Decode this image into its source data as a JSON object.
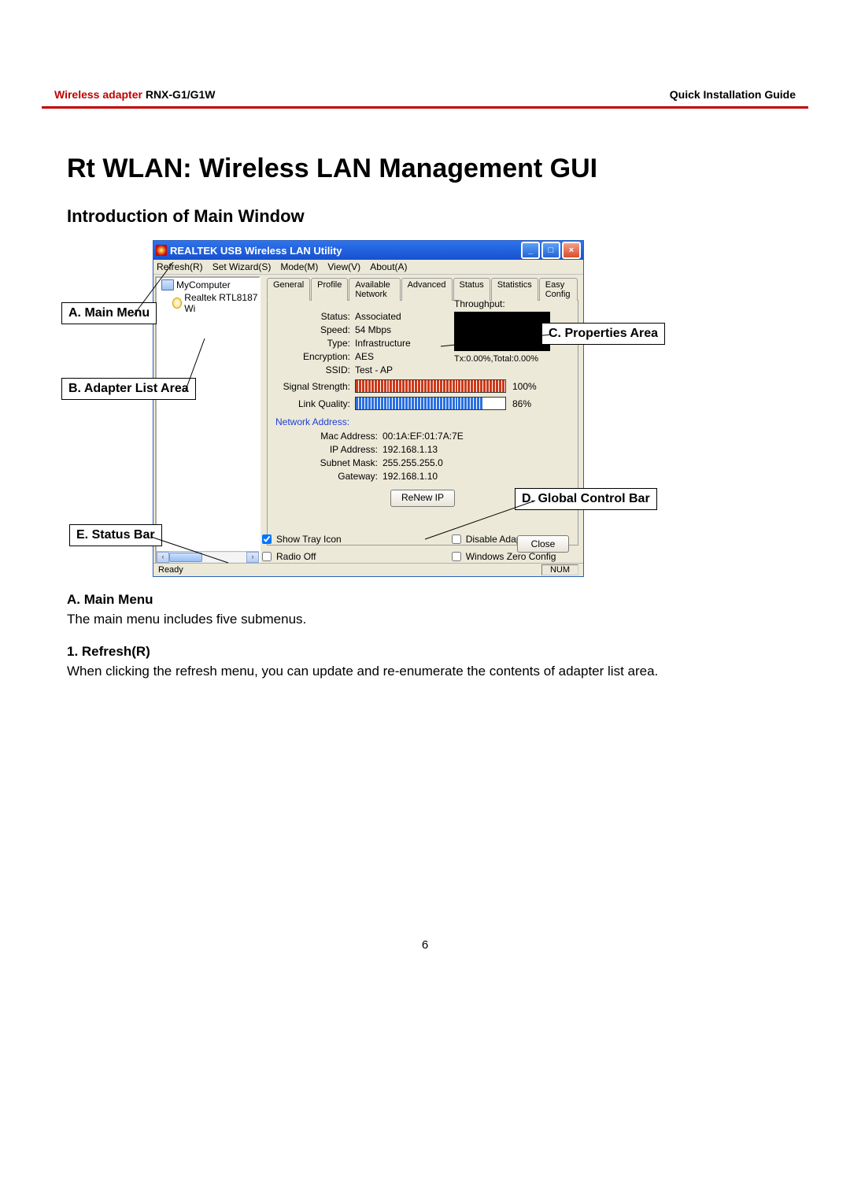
{
  "doc": {
    "header_left_brand": "Wireless adapter ",
    "header_left_model": "RNX-G1/G1W",
    "header_right": "Quick Installation Guide",
    "h1": "Rt WLAN: Wireless LAN Management GUI",
    "h2": "Introduction of Main Window",
    "sectionA_heading": "A.  Main Menu",
    "sectionA_text": "The main menu includes five submenus.",
    "sub1_heading": "1. Refresh(R)",
    "sub1_text": "When clicking the refresh menu, you can update and re-enumerate the contents of adapter list area.",
    "page_number": "6"
  },
  "callouts": {
    "A": "A. Main Menu",
    "B": "B. Adapter List Area",
    "C": "C. Properties Area",
    "D": "D. Global Control Bar",
    "E": "E. Status Bar"
  },
  "app": {
    "title": "REALTEK USB Wireless LAN Utility",
    "menus": {
      "refresh": "Refresh(R)",
      "wizard": "Set Wizard(S)",
      "mode": "Mode(M)",
      "view": "View(V)",
      "about": "About(A)"
    },
    "tree": {
      "root": "MyComputer",
      "child": "Realtek RTL8187 Wi"
    },
    "tabs": {
      "general": "General",
      "profile": "Profile",
      "avail": "Available Network",
      "advanced": "Advanced",
      "status": "Status",
      "stats": "Statistics",
      "easy": "Easy Config"
    },
    "general": {
      "status_l": "Status:",
      "status_v": "Associated",
      "speed_l": "Speed:",
      "speed_v": "54 Mbps",
      "type_l": "Type:",
      "type_v": "Infrastructure",
      "enc_l": "Encryption:",
      "enc_v": "AES",
      "ssid_l": "SSID:",
      "ssid_v": "Test - AP",
      "sig_l": "Signal Strength:",
      "sig_pct": "100%",
      "lq_l": "Link Quality:",
      "lq_pct": "86%",
      "throughput_l": "Throughput:",
      "tx": "Tx:0.00%,Total:0.00%",
      "na_header": "Network Address:",
      "mac_l": "Mac Address:",
      "mac_v": "00:1A:EF:01:7A:7E",
      "ip_l": "IP Address:",
      "ip_v": "192.168.1.13",
      "sm_l": "Subnet Mask:",
      "sm_v": "255.255.255.0",
      "gw_l": "Gateway:",
      "gw_v": "192.168.1.10",
      "renew": "ReNew IP"
    },
    "options": {
      "show_tray": "Show Tray Icon",
      "radio_off": "Radio Off",
      "disable": "Disable Adapter",
      "zero": "Windows Zero Config",
      "close": "Close"
    },
    "status": {
      "ready": "Ready",
      "num": "NUM"
    }
  }
}
